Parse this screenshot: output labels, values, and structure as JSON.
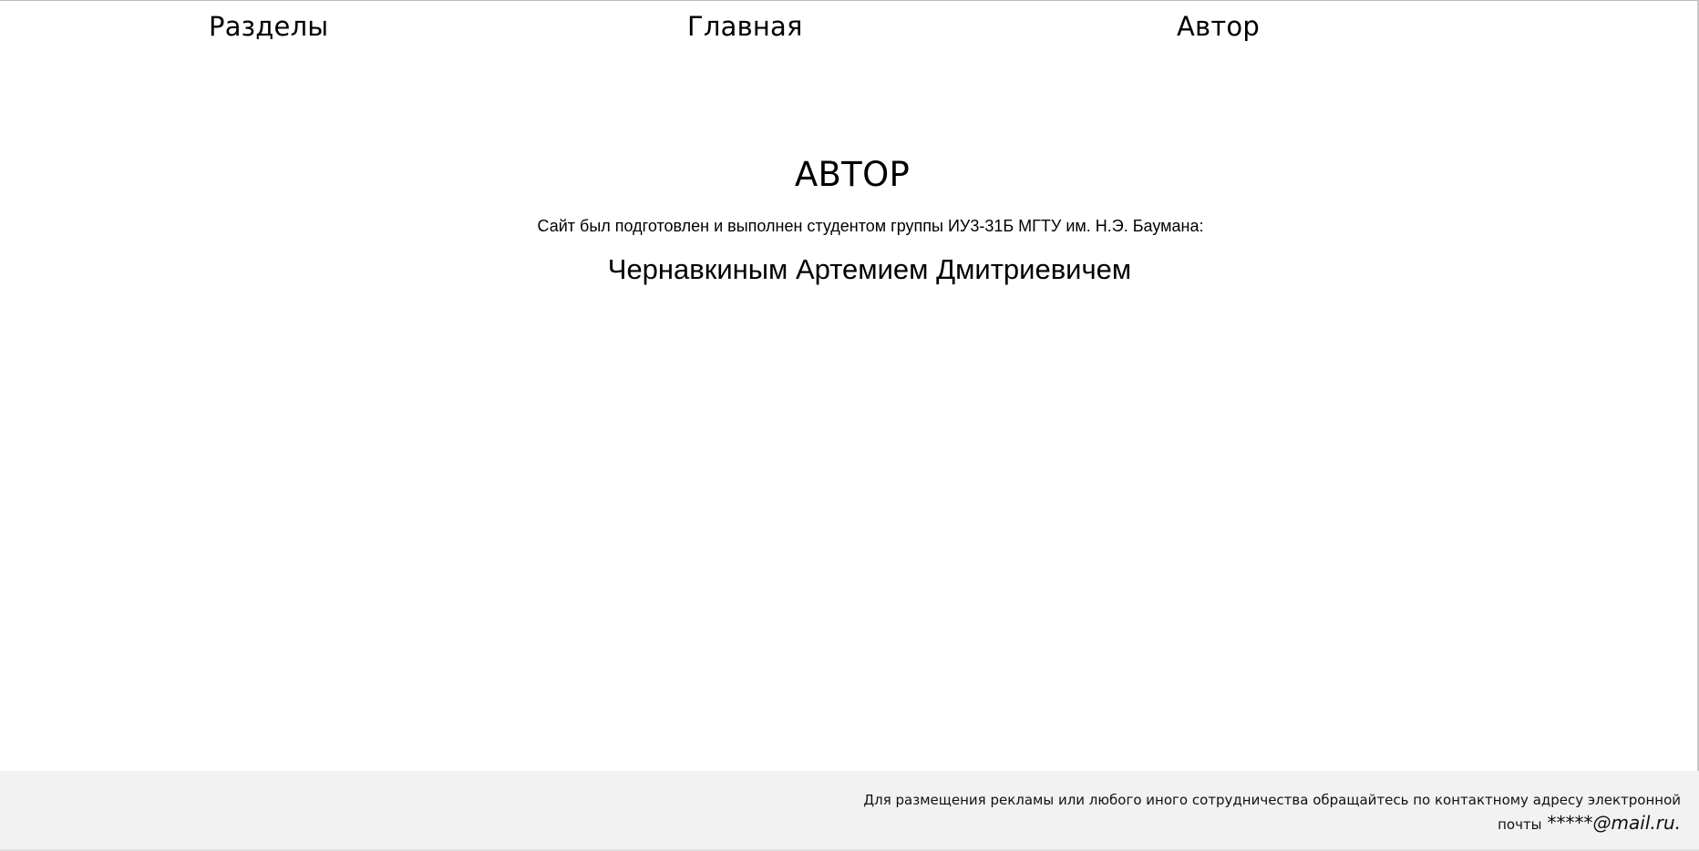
{
  "nav": {
    "sections": "Разделы",
    "home": "Главная",
    "author": "Автор"
  },
  "main": {
    "heading": "АВТОР",
    "intro": "Сайт был подготовлен и выполнен студентом группы ИУ3-31Б МГТУ им. Н.Э. Баумана:",
    "author_name": "Чернавкиным Артемием Дмитриевичем"
  },
  "footer": {
    "text": "Для размещения рекламы или любого иного сотрудничества обращайтесь по контактному адресу электронной почты",
    "email": "*****@mail.ru."
  },
  "colors": {
    "background": "#ffffff",
    "footer_background": "#f2f2f2",
    "text": "#000000"
  }
}
